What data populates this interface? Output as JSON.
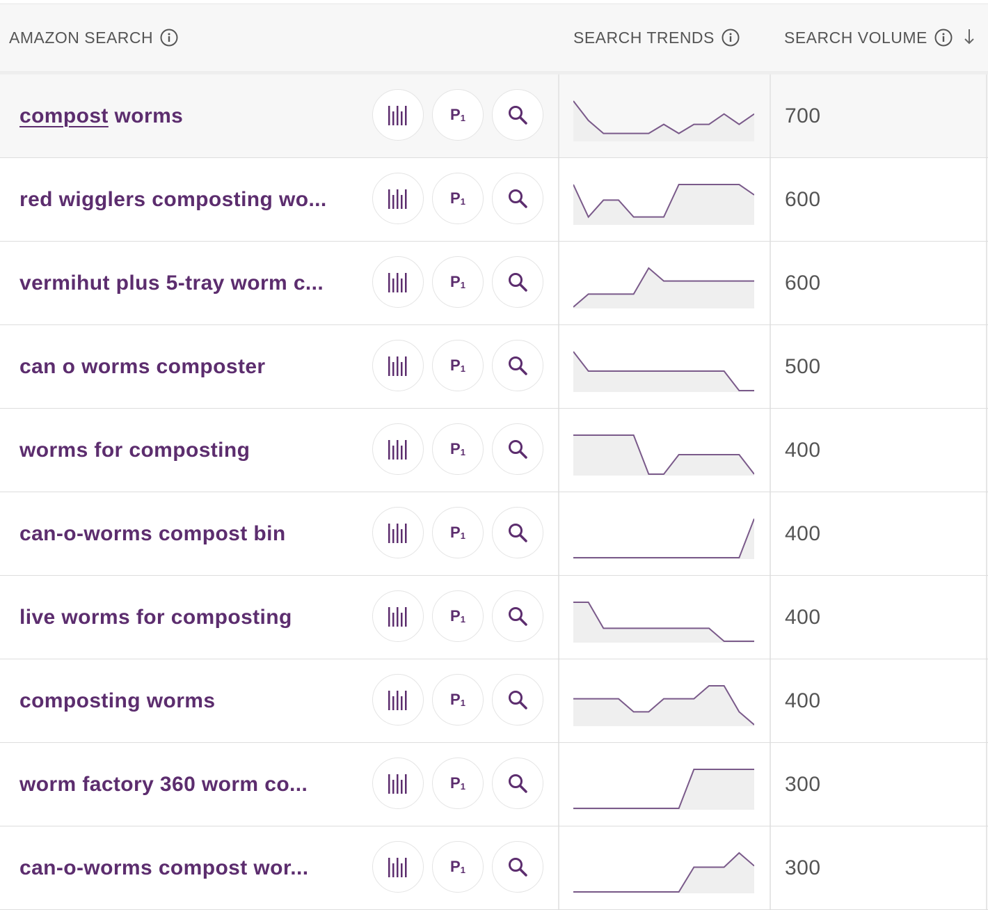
{
  "header": {
    "col_search": "AMAZON SEARCH",
    "col_trends": "SEARCH TRENDS",
    "col_volume": "SEARCH VOLUME"
  },
  "buttons": {
    "product_label": "P",
    "product_sub": "1"
  },
  "colors": {
    "accent": "#5c2d6e",
    "trend_line": "#7a5a8a",
    "trend_fill": "#efefef"
  },
  "rows": [
    {
      "kw_a": "compost",
      "kw_b": " worms",
      "volume": "700",
      "trend": [
        3,
        1.5,
        0.5,
        0.5,
        0.5,
        0.5,
        1.2,
        0.5,
        1.2,
        1.2,
        2,
        1.2,
        2
      ]
    },
    {
      "kw_a": "",
      "kw_b": "red wigglers composting wo...",
      "volume": "600",
      "trend": [
        3,
        0.5,
        1.8,
        1.8,
        0.5,
        0.5,
        0.5,
        3,
        3,
        3,
        3,
        3,
        2.2
      ]
    },
    {
      "kw_a": "",
      "kw_b": "vermihut plus 5-tray worm c...",
      "volume": "600",
      "trend": [
        0,
        1,
        1,
        1,
        1,
        3,
        2,
        2,
        2,
        2,
        2,
        2,
        2
      ]
    },
    {
      "kw_a": "",
      "kw_b": "can o worms composter",
      "volume": "500",
      "trend": [
        3,
        1.5,
        1.5,
        1.5,
        1.5,
        1.5,
        1.5,
        1.5,
        1.5,
        1.5,
        1.5,
        0,
        0
      ]
    },
    {
      "kw_a": "",
      "kw_b": "worms for composting",
      "volume": "400",
      "trend": [
        3,
        3,
        3,
        3,
        3,
        0,
        0,
        1.5,
        1.5,
        1.5,
        1.5,
        1.5,
        0
      ]
    },
    {
      "kw_a": "",
      "kw_b": "can-o-worms compost bin",
      "volume": "400",
      "trend": [
        0,
        0,
        0,
        0,
        0,
        0,
        0,
        0,
        0,
        0,
        0,
        0,
        3
      ]
    },
    {
      "kw_a": "",
      "kw_b": "live worms for composting",
      "volume": "400",
      "trend": [
        3,
        3,
        1,
        1,
        1,
        1,
        1,
        1,
        1,
        1,
        0,
        0,
        0
      ]
    },
    {
      "kw_a": "",
      "kw_b": "composting worms",
      "volume": "400",
      "trend": [
        2,
        2,
        2,
        2,
        1,
        1,
        2,
        2,
        2,
        3,
        3,
        1,
        0
      ]
    },
    {
      "kw_a": "",
      "kw_b": "worm factory 360 worm co...",
      "volume": "300",
      "trend": [
        0,
        0,
        0,
        0,
        0,
        0,
        0,
        0,
        3,
        3,
        3,
        3,
        3
      ]
    },
    {
      "kw_a": "",
      "kw_b": "can-o-worms compost wor...",
      "volume": "300",
      "trend": [
        0,
        0,
        0,
        0,
        0,
        0,
        0,
        0,
        1.9,
        1.9,
        1.9,
        3,
        2
      ]
    }
  ]
}
